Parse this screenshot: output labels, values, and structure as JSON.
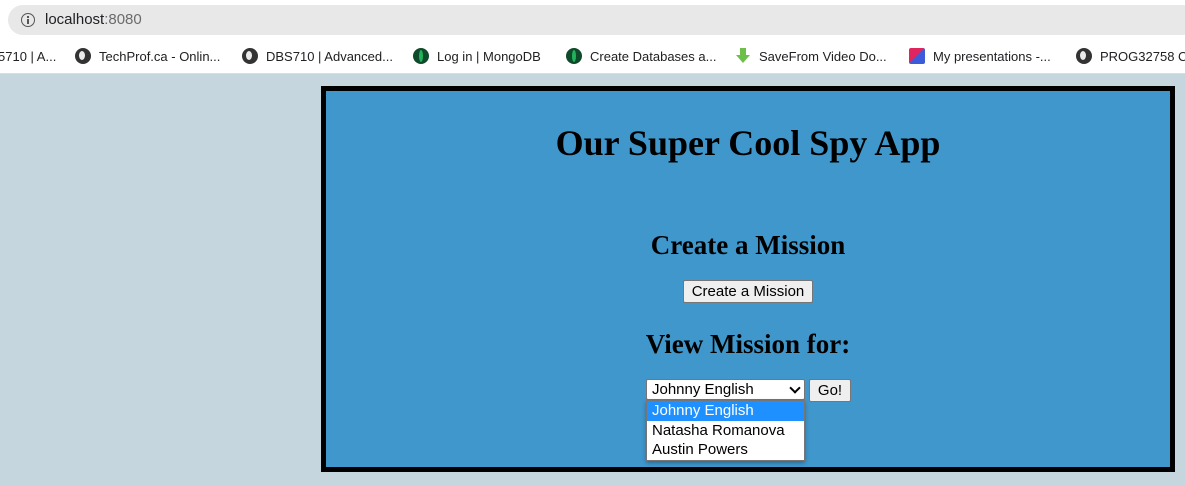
{
  "browser": {
    "url_host": "localhost",
    "url_port": ":8080",
    "bookmarks": [
      {
        "label": "5710 | A...",
        "icon": "none"
      },
      {
        "label": "TechProf.ca - Onlin...",
        "icon": "globe-icon"
      },
      {
        "label": "DBS710 | Advanced...",
        "icon": "globe-icon"
      },
      {
        "label": "Log in | MongoDB",
        "icon": "mongodb-leaf-icon"
      },
      {
        "label": "Create Databases a...",
        "icon": "mongodb-leaf-icon"
      },
      {
        "label": "SaveFrom Video Do...",
        "icon": "download-arrow-icon"
      },
      {
        "label": "My presentations -...",
        "icon": "presentation-icon"
      },
      {
        "label": "PROG32758 C",
        "icon": "globe-icon"
      }
    ]
  },
  "page": {
    "title": "Our Super Cool Spy App",
    "create_heading": "Create a Mission",
    "create_button": "Create a Mission",
    "view_heading": "View Mission for:",
    "selected_agent": "Johnny English",
    "go_button": "Go!",
    "agents": [
      "Johnny English",
      "Natasha Romanova",
      "Austin Powers"
    ]
  },
  "colors": {
    "page_background": "#c5d6df",
    "panel_background": "#3f97cc",
    "panel_border": "#000000",
    "option_highlight": "#1e90ff"
  }
}
